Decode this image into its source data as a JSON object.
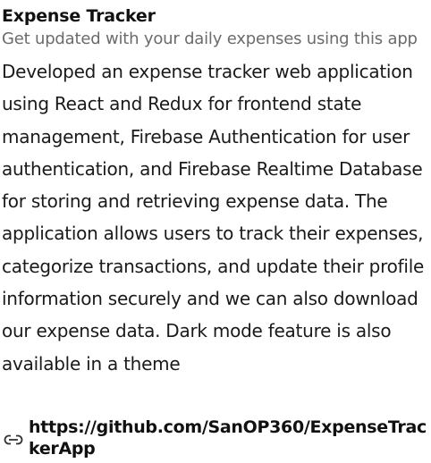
{
  "project": {
    "title": "Expense Tracker",
    "subtitle": "Get updated with your daily expenses using this app",
    "description": "Developed an expense tracker web application using React and Redux for frontend state management, Firebase Authentication for user authentication, and Firebase Realtime Database for storing and retrieving expense data. The application allows users to track their expenses, categorize transactions, and update their profile information securely and we can also download our expense data. Dark mode feature is also available in a theme",
    "link_icon": "link-icon",
    "link_text": "https://github.com/SanOP360/ExpenseTrackerApp"
  }
}
